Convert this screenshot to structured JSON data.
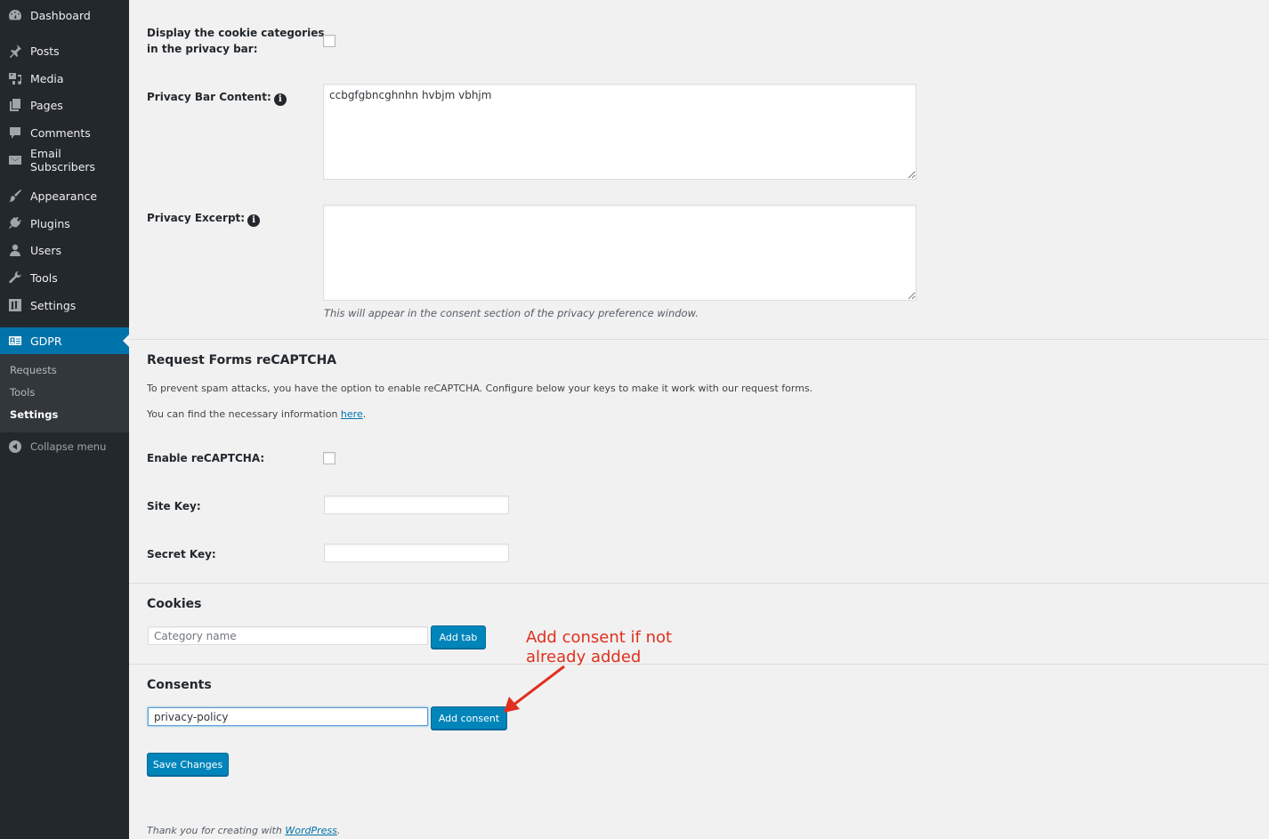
{
  "sidebar": {
    "items": [
      {
        "label": "Dashboard",
        "icon": "dashboard-icon"
      },
      {
        "label": "Posts",
        "icon": "pin-icon"
      },
      {
        "label": "Media",
        "icon": "media-icon"
      },
      {
        "label": "Pages",
        "icon": "pages-icon"
      },
      {
        "label": "Comments",
        "icon": "comment-icon"
      },
      {
        "label": "Email Subscribers",
        "icon": "envelope-icon"
      },
      {
        "label": "Appearance",
        "icon": "paintbrush-icon"
      },
      {
        "label": "Plugins",
        "icon": "plugin-icon"
      },
      {
        "label": "Users",
        "icon": "user-icon"
      },
      {
        "label": "Tools",
        "icon": "wrench-icon"
      },
      {
        "label": "Settings",
        "icon": "settings-icon"
      },
      {
        "label": "GDPR",
        "icon": "id-card-icon",
        "active": true
      }
    ],
    "submenu": [
      {
        "label": "Requests"
      },
      {
        "label": "Tools"
      },
      {
        "label": "Settings",
        "current": true
      }
    ],
    "collapse_label": "Collapse menu"
  },
  "form": {
    "cookie_categories_label_line1": "Display the cookie categories",
    "cookie_categories_label_line2": "in the privacy bar:",
    "cookie_categories_checked": false,
    "privacy_bar_content_label": "Privacy Bar Content:",
    "privacy_bar_content_value": "ccbgfgbncghnhn hvbjm vbhjm",
    "privacy_excerpt_label": "Privacy Excerpt:",
    "privacy_excerpt_value": "",
    "privacy_excerpt_desc": "This will appear in the consent section of the privacy preference window."
  },
  "recaptcha": {
    "heading": "Request Forms reCAPTCHA",
    "intro": "To prevent spam attacks, you have the option to enable reCAPTCHA. Configure below your keys to make it work with our request forms.",
    "info_prefix": "You can find the necessary information ",
    "info_link": "here",
    "info_suffix": ".",
    "enable_label": "Enable reCAPTCHA:",
    "enable_checked": false,
    "site_key_label": "Site Key:",
    "site_key_value": "",
    "secret_key_label": "Secret Key:",
    "secret_key_value": ""
  },
  "cookies": {
    "heading": "Cookies",
    "category_placeholder": "Category name",
    "add_tab_label": "Add tab"
  },
  "consents": {
    "heading": "Consents",
    "consent_value": "privacy-policy",
    "add_consent_label": "Add consent"
  },
  "save_label": "Save Changes",
  "annotation": {
    "line1": "Add consent if not",
    "line2": "already added",
    "color": "#e0301e"
  },
  "footer": {
    "prefix": "Thank you for creating with ",
    "link": "WordPress",
    "suffix": "."
  }
}
